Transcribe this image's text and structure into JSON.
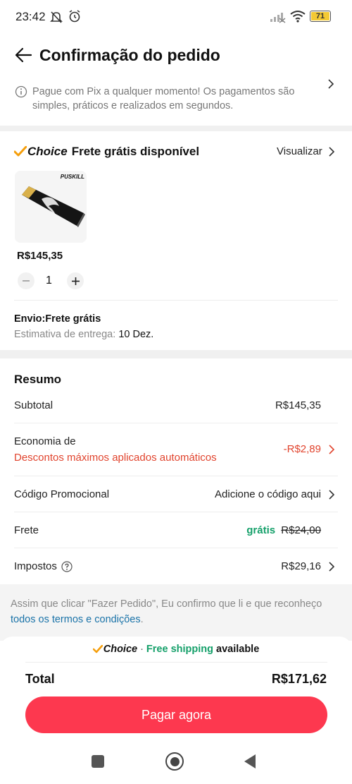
{
  "status": {
    "time": "23:42",
    "battery": "71"
  },
  "header": {
    "title": "Confirmação do pedido"
  },
  "pix": {
    "text": "Pague com Pix a qualquer momento! Os pagamentos são simples, práticos e realizados em segundos."
  },
  "choice": {
    "brand": "Choice",
    "title": "Frete grátis disponível",
    "view_label": "Visualizar",
    "product": {
      "image_brand": "PUSKILL",
      "price": "R$145,35",
      "quantity": "1"
    },
    "shipping_label": "Envio:Frete grátis",
    "delivery_label": "Estimativa de entrega:",
    "delivery_date": "10 Dez."
  },
  "summary": {
    "title": "Resumo",
    "subtotal_label": "Subtotal",
    "subtotal_value": "R$145,35",
    "economy_label": "Economia de",
    "economy_sub": "Descontos máximos aplicados automáticos",
    "economy_value": "-R$2,89",
    "promo_label": "Código Promocional",
    "promo_value": "Adicione o código aqui",
    "shipping_label": "Frete",
    "shipping_free": "grátis",
    "shipping_old": "R$24,00",
    "tax_label": "Impostos",
    "tax_value": "R$29,16"
  },
  "terms": {
    "text": "Assim que clicar \"Fazer Pedido\", Eu confirmo que li e que reconheço",
    "link": "todos os termos e condições",
    "period": "."
  },
  "bottom": {
    "choice_brand": "Choice",
    "separator": "·",
    "free_shipping": "Free shipping",
    "available": "available",
    "total_label": "Total",
    "total_value": "R$171,62",
    "pay_label": "Pagar agora"
  },
  "colors": {
    "accent": "#fd384f",
    "discount": "#e1442e",
    "green": "#15a06a",
    "choice_check": "#f59e0b",
    "link": "#1a73a8"
  }
}
